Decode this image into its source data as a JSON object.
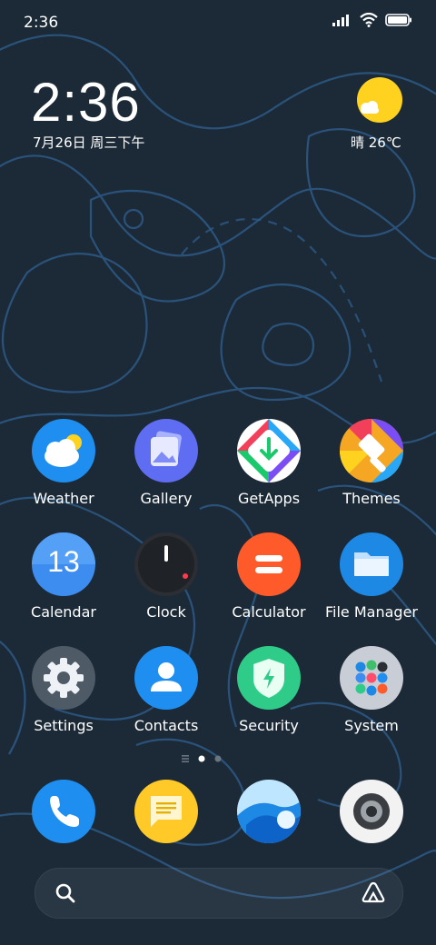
{
  "status_bar": {
    "time": "2:36"
  },
  "widget": {
    "time": "2:36",
    "date": "7月26日 周三下午",
    "weather": "晴 26℃"
  },
  "apps": [
    {
      "label": "Weather"
    },
    {
      "label": "Gallery"
    },
    {
      "label": "GetApps"
    },
    {
      "label": "Themes"
    },
    {
      "label": "Calendar",
      "badge": "13"
    },
    {
      "label": "Clock"
    },
    {
      "label": "Calculator"
    },
    {
      "label": "File Manager"
    },
    {
      "label": "Settings"
    },
    {
      "label": "Contacts"
    },
    {
      "label": "Security"
    },
    {
      "label": "System"
    }
  ],
  "dock": [
    {
      "icon": "phone-icon"
    },
    {
      "icon": "messages-icon"
    },
    {
      "icon": "browser-icon"
    },
    {
      "icon": "camera-icon"
    }
  ],
  "colors": {
    "background": "#1c2a38",
    "contour": "#2f5a85",
    "accent": "#1e88e5"
  }
}
